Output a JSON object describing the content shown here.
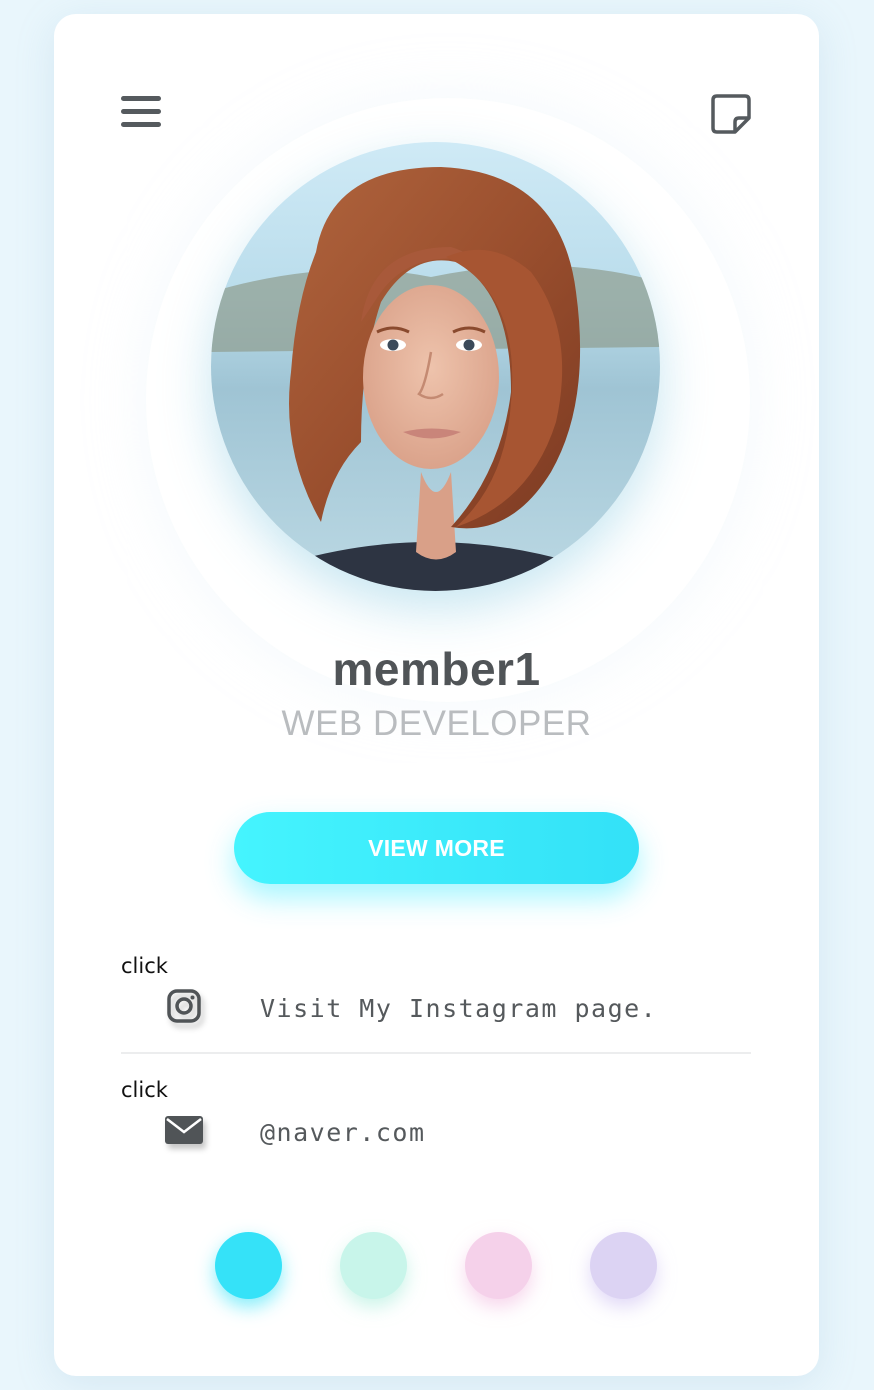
{
  "profile": {
    "name": "member1",
    "role": "WEB DEVELOPER",
    "photo_description_icon": "avatar-photo"
  },
  "header": {
    "menu_icon": "hamburger-menu-icon",
    "note_icon": "sticky-note-icon"
  },
  "actions": {
    "view_more_label": "VIEW MORE"
  },
  "contacts": [
    {
      "click_label": "click",
      "icon": "instagram-icon",
      "text": "Visit My Instagram page."
    },
    {
      "click_label": "click",
      "icon": "envelope-icon",
      "text": "@naver.com"
    }
  ],
  "theme_dots": [
    {
      "name": "cyan",
      "color": "#35e2f8"
    },
    {
      "name": "mint",
      "color": "#c8f5ea"
    },
    {
      "name": "pink",
      "color": "#f5d1ea"
    },
    {
      "name": "lavender",
      "color": "#dcd3f3"
    }
  ],
  "colors": {
    "accent": "#3ee9fb",
    "text_dark": "#505457",
    "text_muted": "#b9bcbf"
  }
}
